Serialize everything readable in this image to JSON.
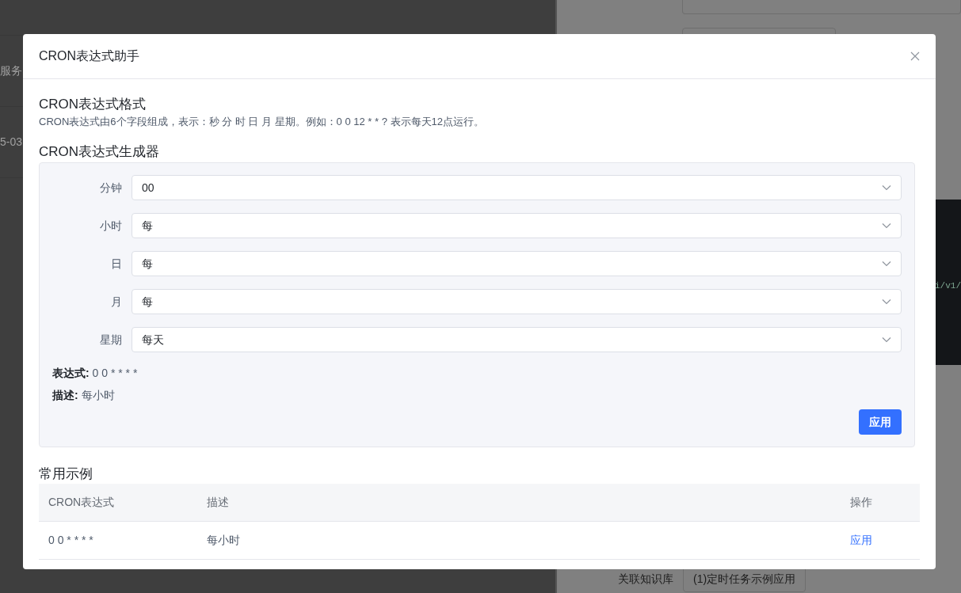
{
  "background": {
    "left_texts": [
      "服务",
      "5-03"
    ],
    "code_snippet": "i/v1/",
    "field_label": "关联知识库",
    "field_value": "(1)定时任务示例应用"
  },
  "dialog": {
    "title": "CRON表达式助手",
    "format_section": {
      "heading": "CRON表达式格式",
      "text": "CRON表达式由6个字段组成，表示：秒 分 时 日 月 星期。例如：0 0 12 * * ? 表示每天12点运行。"
    },
    "generator": {
      "heading": "CRON表达式生成器",
      "fields": [
        {
          "label": "分钟",
          "value": "00"
        },
        {
          "label": "小时",
          "value": "每"
        },
        {
          "label": "日",
          "value": "每"
        },
        {
          "label": "月",
          "value": "每"
        },
        {
          "label": "星期",
          "value": "每天"
        }
      ],
      "expression": {
        "label": "表达式:",
        "value": "0 0 * * * *"
      },
      "description": {
        "label": "描述:",
        "value": "每小时"
      },
      "apply_button": "应用"
    },
    "examples": {
      "heading": "常用示例",
      "columns": [
        "CRON表达式",
        "描述",
        "操作"
      ],
      "rows": [
        {
          "expression": "0 0 * * * *",
          "description": "每小时",
          "action": "应用"
        }
      ]
    }
  }
}
